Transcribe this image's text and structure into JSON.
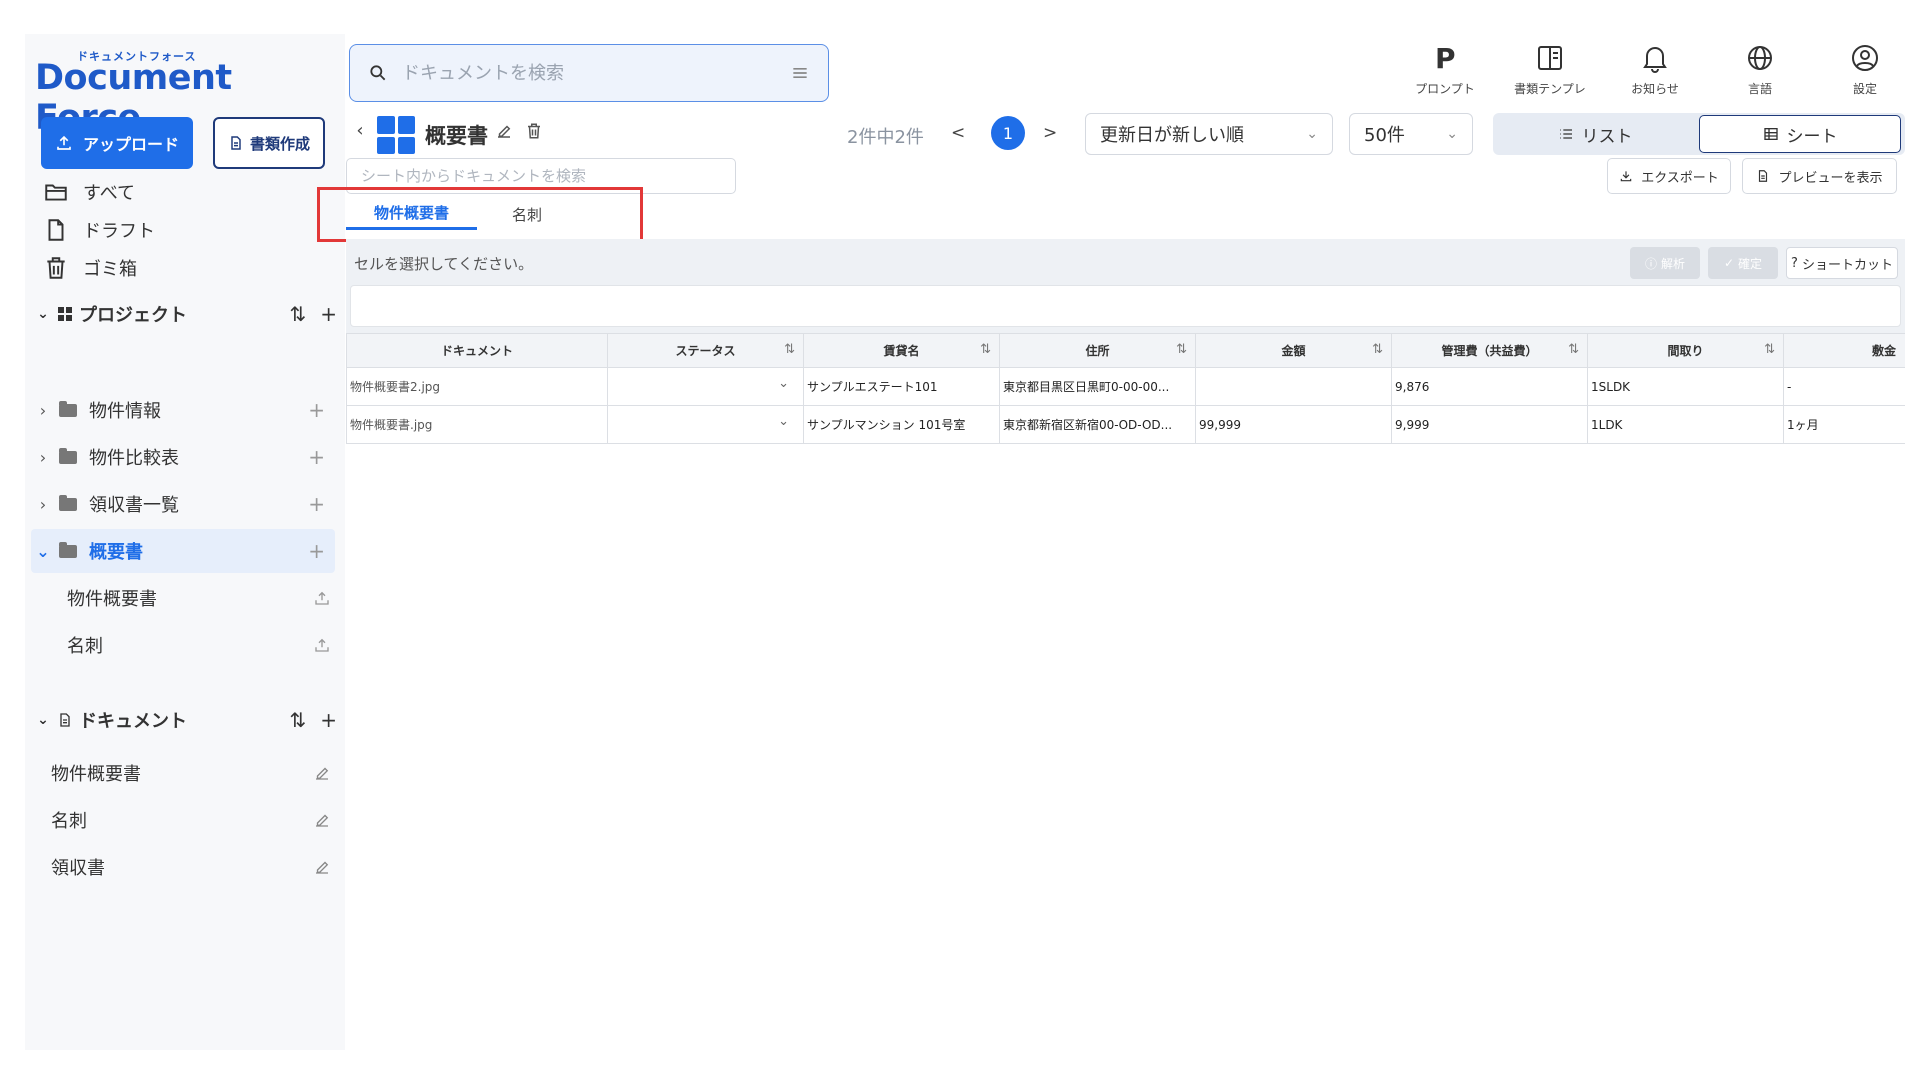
{
  "logo": {
    "small": "ドキュメントフォース",
    "main": "Document Force"
  },
  "sidebar": {
    "upload_label": "アップロード",
    "create_label": "書類作成",
    "nav": [
      {
        "label": "すべて",
        "icon": "folder-open-icon"
      },
      {
        "label": "ドラフト",
        "icon": "file-icon"
      },
      {
        "label": "ゴミ箱",
        "icon": "trash-icon"
      }
    ],
    "projects_title": "プロジェクト",
    "projects": [
      {
        "label": "物件情報",
        "expanded": false
      },
      {
        "label": "物件比較表",
        "expanded": false
      },
      {
        "label": "領収書一覧",
        "expanded": false
      },
      {
        "label": "概要書",
        "expanded": true,
        "active": true
      }
    ],
    "project_children": [
      {
        "label": "物件概要書"
      },
      {
        "label": "名刺"
      }
    ],
    "documents_title": "ドキュメント",
    "documents": [
      {
        "label": "物件概要書"
      },
      {
        "label": "名刺"
      },
      {
        "label": "領収書"
      }
    ]
  },
  "header": {
    "search_placeholder": "ドキュメントを検索",
    "icons": [
      {
        "label": "プロンプト",
        "icon": "prompt-p-icon"
      },
      {
        "label": "書類テンプレ",
        "icon": "template-icon"
      },
      {
        "label": "お知らせ",
        "icon": "bell-icon"
      },
      {
        "label": "言語",
        "icon": "globe-icon"
      },
      {
        "label": "設定",
        "icon": "user-settings-icon"
      }
    ]
  },
  "toolbar": {
    "title": "概要書",
    "count_text": "2件中2件",
    "prev": "<",
    "current_page": "1",
    "next": ">",
    "sort_select": "更新日が新しい順",
    "per_page_select": "50件",
    "view_list": "リスト",
    "view_sheet": "シート",
    "sheet_search_placeholder": "シート内からドキュメントを検索",
    "export_label": "エクスポート",
    "preview_label": "プレビューを表示"
  },
  "tabs": [
    {
      "label": "物件概要書",
      "active": true
    },
    {
      "label": "名刺",
      "active": false
    }
  ],
  "cell_bar": {
    "message": "セルを選択してください。",
    "analyze_label": "解析",
    "confirm_label": "確定",
    "shortcut_label": "ショートカット"
  },
  "table": {
    "columns": [
      "ドキュメント",
      "ステータス",
      "賃貸名",
      "住所",
      "金額",
      "管理費（共益費）",
      "間取り",
      "敷金"
    ],
    "rows": [
      [
        "物件概要書2.jpg",
        "",
        "サンプルエステート101",
        "東京都目黒区日黒町0-00-00...",
        "",
        "9,876",
        "1SLDK",
        "-"
      ],
      [
        "物件概要書.jpg",
        "",
        "サンプルマンション 101号室",
        "東京都新宿区新宿00-OD-OD...",
        "99,999",
        "9,999",
        "1LDK",
        "1ヶ月"
      ]
    ]
  },
  "colors": {
    "accent": "#1f6ee8",
    "highlight": "#e23838",
    "navy": "#1f3a7a"
  }
}
